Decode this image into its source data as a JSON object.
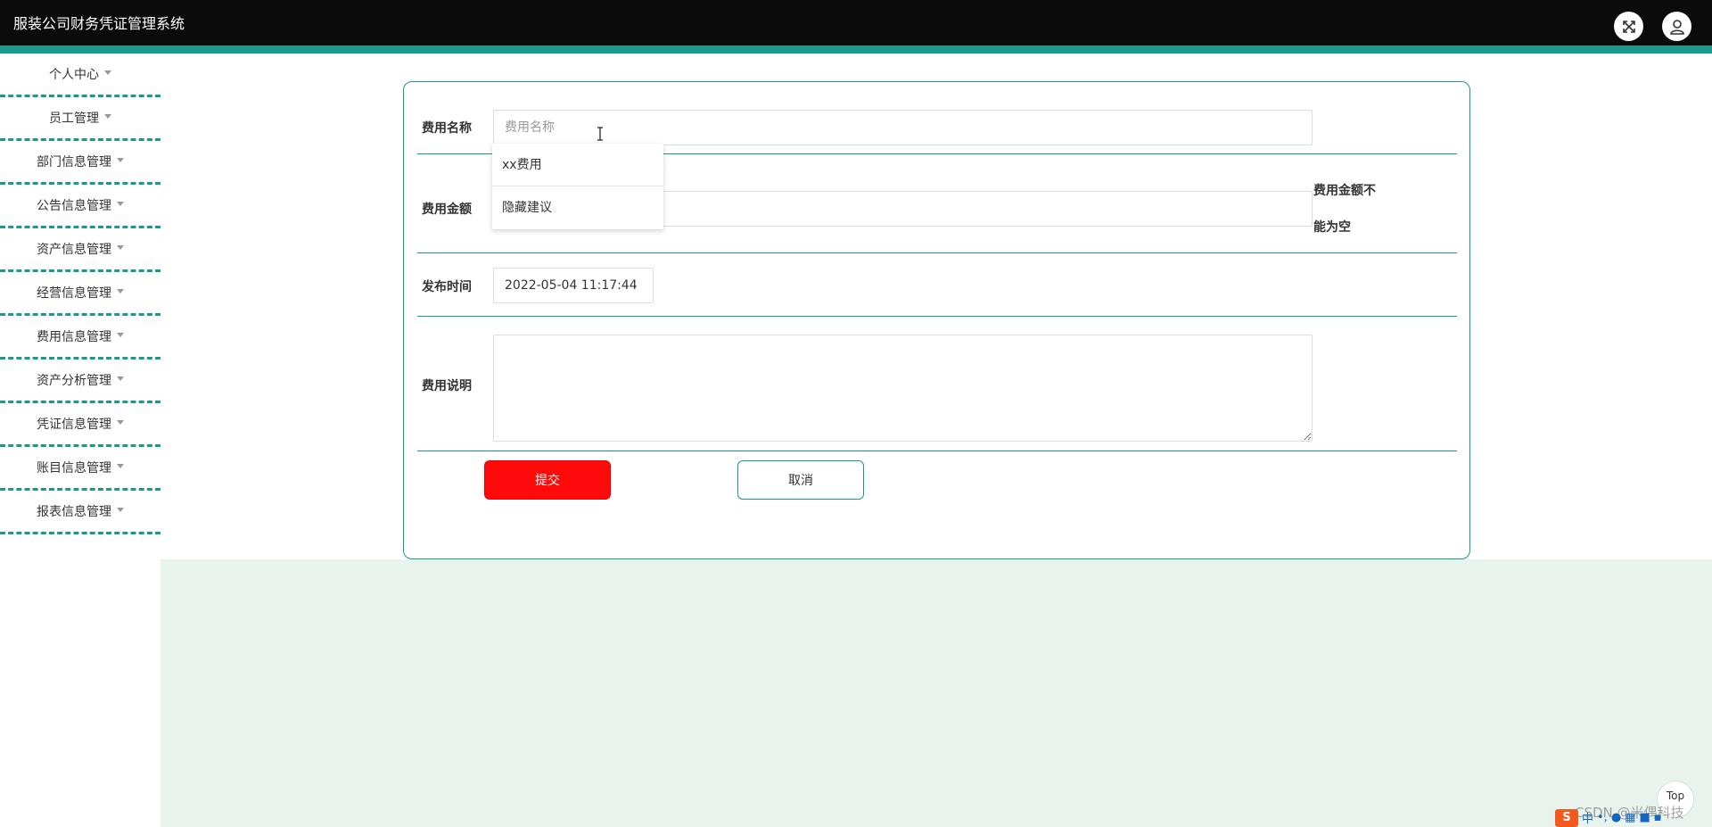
{
  "header": {
    "title": "服装公司财务凭证管理系统",
    "fullscreen_icon": "expand-icon",
    "user_icon": "user-icon"
  },
  "sidebar": {
    "items": [
      {
        "label": "个人中心"
      },
      {
        "label": "员工管理"
      },
      {
        "label": "部门信息管理"
      },
      {
        "label": "公告信息管理"
      },
      {
        "label": "资产信息管理"
      },
      {
        "label": "经营信息管理"
      },
      {
        "label": "费用信息管理"
      },
      {
        "label": "资产分析管理"
      },
      {
        "label": "凭证信息管理"
      },
      {
        "label": "账目信息管理"
      },
      {
        "label": "报表信息管理"
      }
    ]
  },
  "form": {
    "name": {
      "label": "费用名称",
      "placeholder": "费用名称",
      "value": ""
    },
    "amount": {
      "label": "费用金额",
      "value": "",
      "error": [
        "费用金额不",
        "能为空"
      ]
    },
    "publish_time": {
      "label": "发布时间",
      "value": "2022-05-04 11:17:44"
    },
    "description": {
      "label": "费用说明",
      "value": ""
    },
    "submit_label": "提交",
    "cancel_label": "取消"
  },
  "autocomplete": {
    "items": [
      "xx费用",
      "隐藏建议"
    ]
  },
  "misc": {
    "top_label": "Top",
    "watermark": "CSDN @米偶科技",
    "ime_logo": "S",
    "ime_lang": "中"
  },
  "colors": {
    "accent": "#1a9a8a",
    "submit": "#ff0a0a",
    "header_bg": "#0b0b0b",
    "main_bg": "#e8f3ee"
  }
}
